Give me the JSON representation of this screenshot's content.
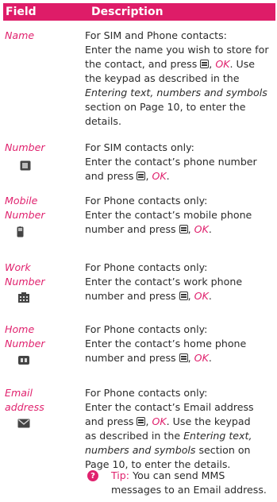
{
  "header": {
    "field_label": "Field",
    "description_label": "Description"
  },
  "colors": {
    "accent": "#de1c68",
    "text": "#2b2b2b"
  },
  "rows": [
    {
      "field_lines": [
        "Name"
      ],
      "icon": "",
      "intro": "For SIM and Phone contacts:",
      "l1": "Enter the name you wish to store for",
      "l2a": "the contact, and press",
      "l2ok": "OK",
      "l2b": ". Use",
      "l3": "the keypad as described in the",
      "l4i": "Entering text, numbers and symbols",
      "l5": "section on Page 10, to enter the",
      "l6": "details."
    },
    {
      "field_lines": [
        "Number"
      ],
      "icon": "sim-card-icon",
      "intro": "For SIM contacts only:",
      "l1": "Enter the contact’s phone number",
      "l2a": "and press",
      "l2ok": "OK",
      "l2b": "."
    },
    {
      "field_lines": [
        "Mobile",
        "Number"
      ],
      "icon": "mobile-phone-icon",
      "intro": "For Phone contacts only:",
      "l1": "Enter the contact’s mobile phone",
      "l2a": "number and press",
      "l2ok": "OK",
      "l2b": "."
    },
    {
      "field_lines": [
        "Work",
        "Number"
      ],
      "icon": "office-building-icon",
      "intro": "For Phone contacts only:",
      "l1": "Enter the contact’s work phone",
      "l2a": "number and press",
      "l2ok": "OK",
      "l2b": "."
    },
    {
      "field_lines": [
        "Home",
        "Number"
      ],
      "icon": "home-icon",
      "intro": "For Phone contacts only:",
      "l1": "Enter the contact’s home phone",
      "l2a": "number and press",
      "l2ok": "OK",
      "l2b": "."
    },
    {
      "field_lines": [
        "Email",
        "address"
      ],
      "icon": "envelope-icon",
      "intro": "For Phone contacts only:",
      "l1": "Enter the contact’s Email address",
      "l2a": "and press",
      "l2ok": "OK",
      "l2b": ". Use the keypad",
      "l3": "as described in the",
      "l3i": "Entering text,",
      "l4i": "numbers and symbols",
      "l4b": "section on",
      "l5": "Page 10, to enter the details."
    }
  ],
  "tip": {
    "icon": "question-icon",
    "label": "Tip:",
    "text1": "You can send MMS",
    "text2": "messages to an Email address."
  }
}
